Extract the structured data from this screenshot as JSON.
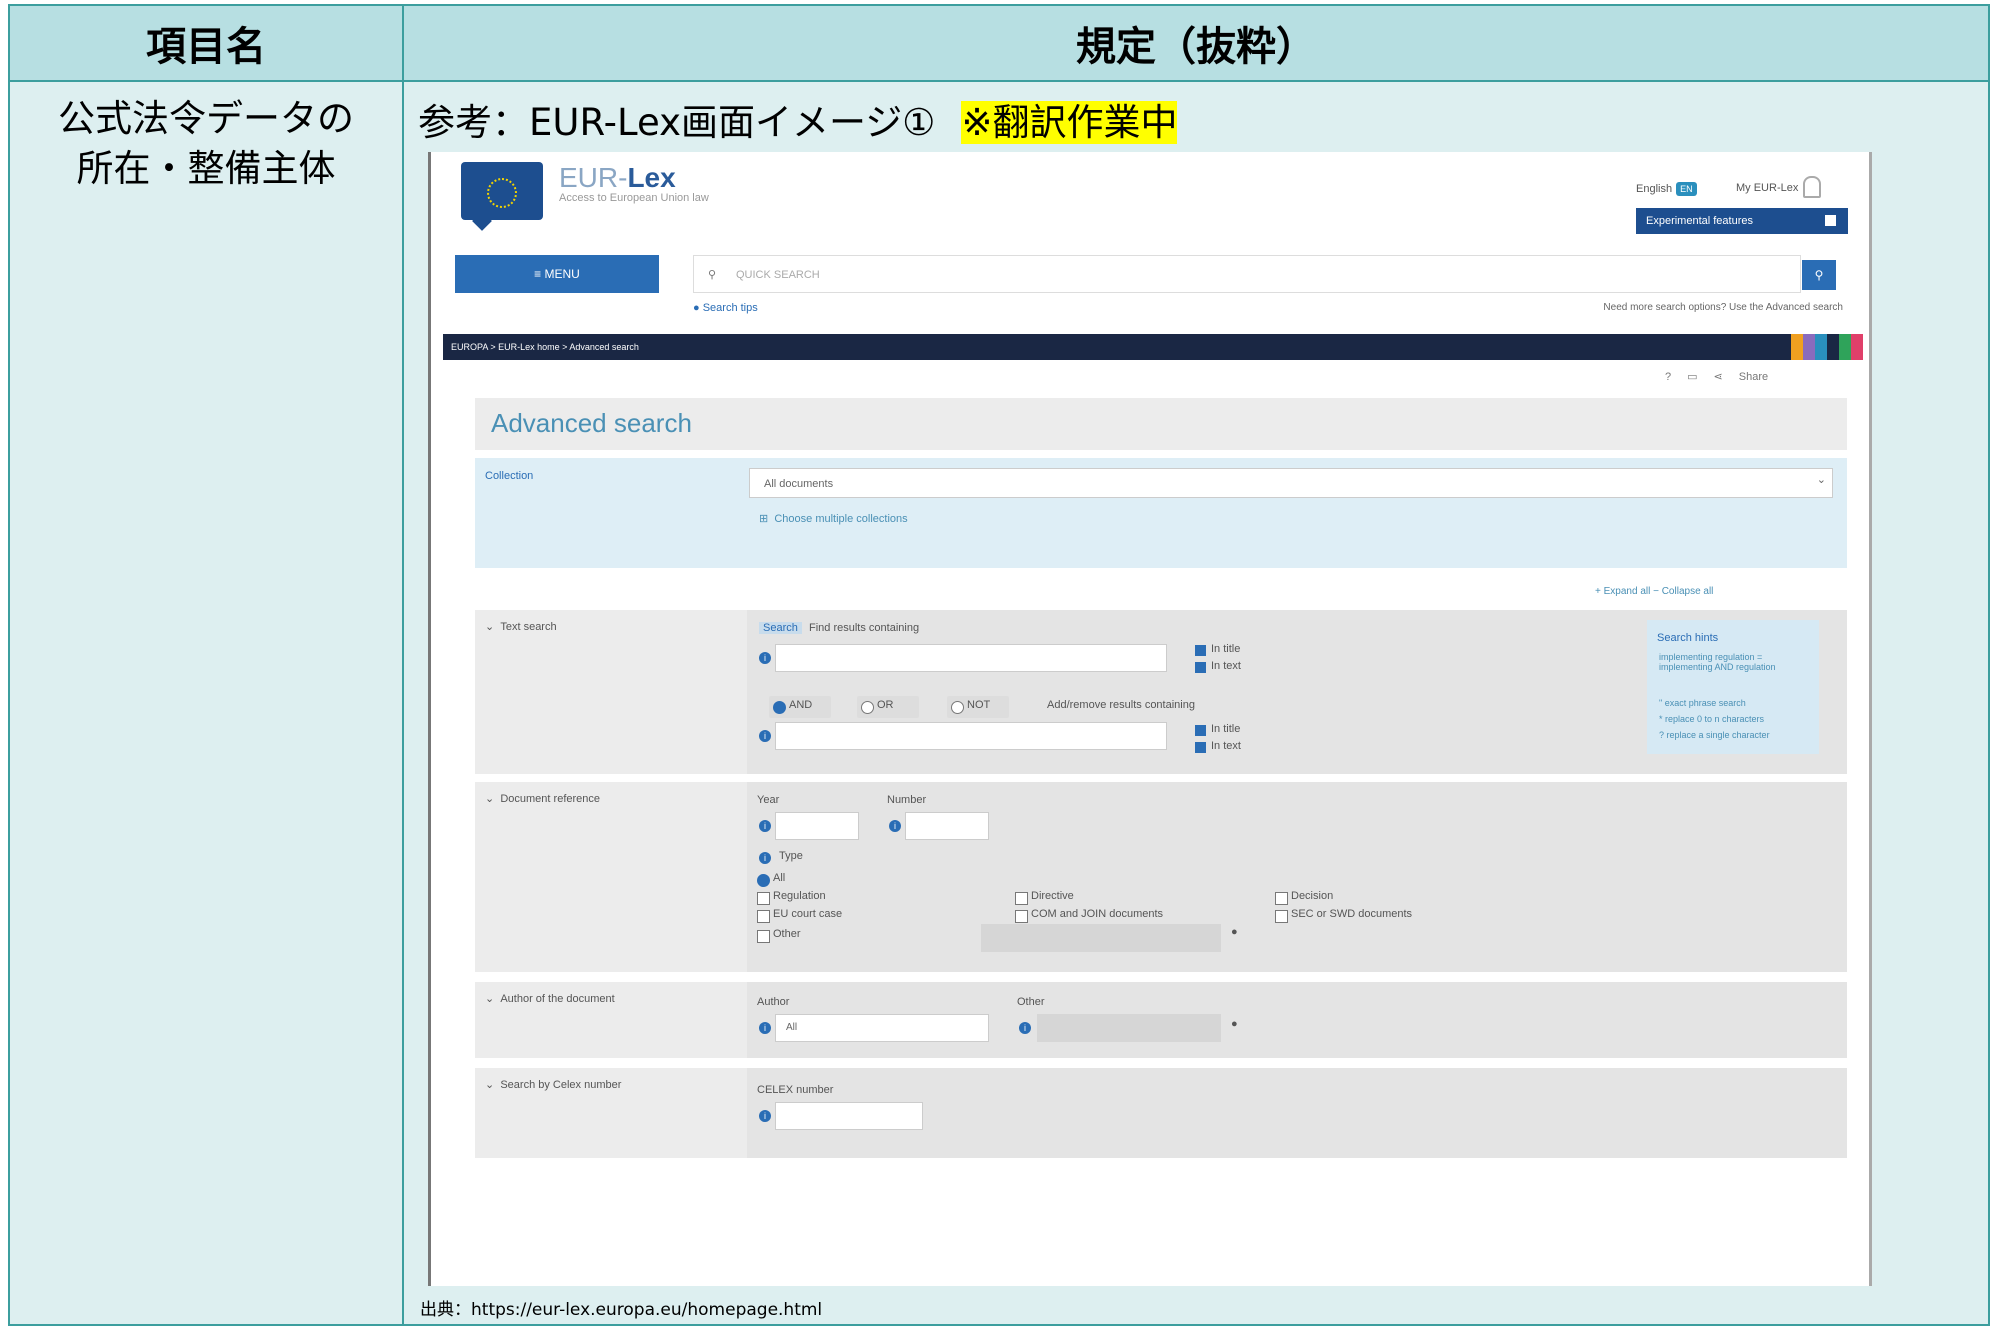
{
  "table": {
    "col1_header": "項目名",
    "col2_header": "規定（抜粋）",
    "item_name_line1": "公式法令データの",
    "item_name_line2": "所在・整備主体",
    "reference_text": "参考：EUR-Lex画面イメージ①",
    "highlight": "※翻訳作業中",
    "source": "出典：https://eur-lex.europa.eu/homepage.html"
  },
  "screenshot": {
    "brand_prefix": "EUR-",
    "brand_suffix": "Lex",
    "brand_sub": "Access to European Union law",
    "lang": "English",
    "lang_code": "EN",
    "my_eurlex": "My EUR-Lex",
    "experimental": "Experimental features",
    "menu": "≡  MENU",
    "quick_search": "QUICK SEARCH",
    "search_tips": "Search tips",
    "need_more": "Need more search options? Use the Advanced search",
    "breadcrumb": "EUROPA  >  EUR-Lex home  >  Advanced search",
    "share": "Share",
    "adv_title": "Advanced search",
    "collection_label": "Collection",
    "collection_value": "All documents",
    "choose_multi": "Choose multiple collections",
    "expand": "+ Expand all   − Collapse all",
    "text_search": "Text search",
    "search_tag": "Search",
    "find_results": "Find results containing",
    "in_title": "In title",
    "in_text": "In text",
    "and": "AND",
    "or": "OR",
    "not": "NOT",
    "add_remove": "Add/remove results containing",
    "hints_title": "Search hints",
    "hint1": "implementing regulation = implementing AND regulation",
    "hint2": "\" exact phrase search",
    "hint3": "* replace 0 to n characters",
    "hint4": "? replace a single character",
    "doc_ref": "Document reference",
    "year": "Year",
    "number": "Number",
    "type": "Type",
    "all": "All",
    "regulation": "Regulation",
    "directive": "Directive",
    "decision": "Decision",
    "eu_court": "EU court case",
    "com_join": "COM and JOIN documents",
    "sec_swd": "SEC or SWD documents",
    "other": "Other",
    "author_sec": "Author of the document",
    "author": "Author",
    "author_value": "All",
    "other2": "Other",
    "celex_sec": "Search by Celex number",
    "celex": "CELEX number"
  }
}
